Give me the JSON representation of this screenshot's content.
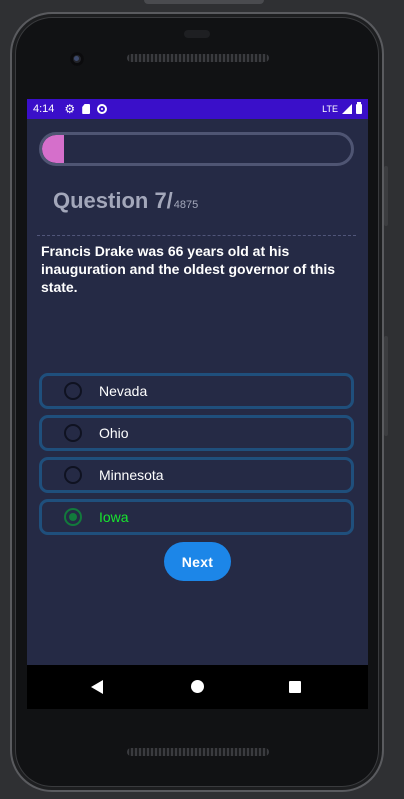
{
  "status_bar": {
    "time": "4:14",
    "network": "LTE",
    "icons": [
      "gear-icon",
      "sd-card-icon",
      "data-saver-icon",
      "signal-icon",
      "battery-icon"
    ]
  },
  "quiz": {
    "progress_fraction": 0.07,
    "progress_color": "#d56fcb",
    "question_label": "Question 7/",
    "question_total": "4875",
    "question_text": "Francis Drake was 66 years old at his inauguration and the oldest governor of this state.",
    "options": [
      {
        "label": "Nevada",
        "selected": false
      },
      {
        "label": "Ohio",
        "selected": false
      },
      {
        "label": "Minnesota",
        "selected": false
      },
      {
        "label": "Iowa",
        "selected": true
      }
    ],
    "next_label": "Next"
  },
  "colors": {
    "screen_bg": "#252a45",
    "status_bar_bg": "#3a0fc9",
    "option_border": "#1f4f7c",
    "selected_text": "#17e62e",
    "button_bg": "#1c86e8"
  },
  "nav_bar": {
    "icons": [
      "back-icon",
      "home-icon",
      "recents-icon"
    ]
  }
}
